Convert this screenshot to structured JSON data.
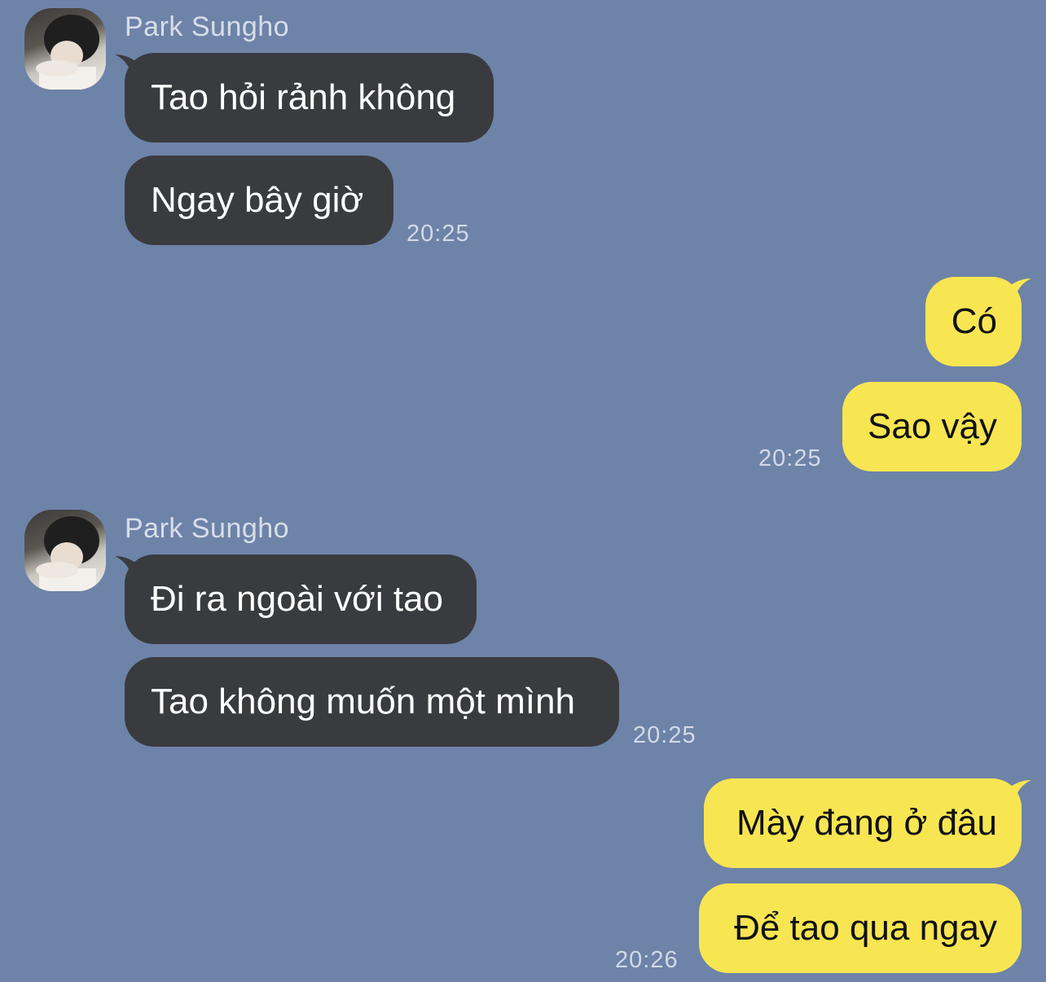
{
  "contact": {
    "name": "Park Sungho"
  },
  "groups": [
    {
      "sender": "Park Sungho",
      "messages": [
        "Tao hỏi rảnh không",
        "Ngay bây giờ"
      ],
      "time": "20:25"
    },
    {
      "sender": "me",
      "messages": [
        "Có",
        "Sao vậy"
      ],
      "time": "20:25"
    },
    {
      "sender": "Park Sungho",
      "messages": [
        "Đi ra ngoài với tao",
        "Tao không muốn một mình"
      ],
      "time": "20:25"
    },
    {
      "sender": "me",
      "messages": [
        "Mày đang ở đâu",
        "Để tao qua ngay"
      ],
      "time": "20:26"
    }
  ],
  "colors": {
    "background": "#6e83a8",
    "incoming_bubble": "#3a3b3f",
    "outgoing_bubble": "#f8e552"
  }
}
